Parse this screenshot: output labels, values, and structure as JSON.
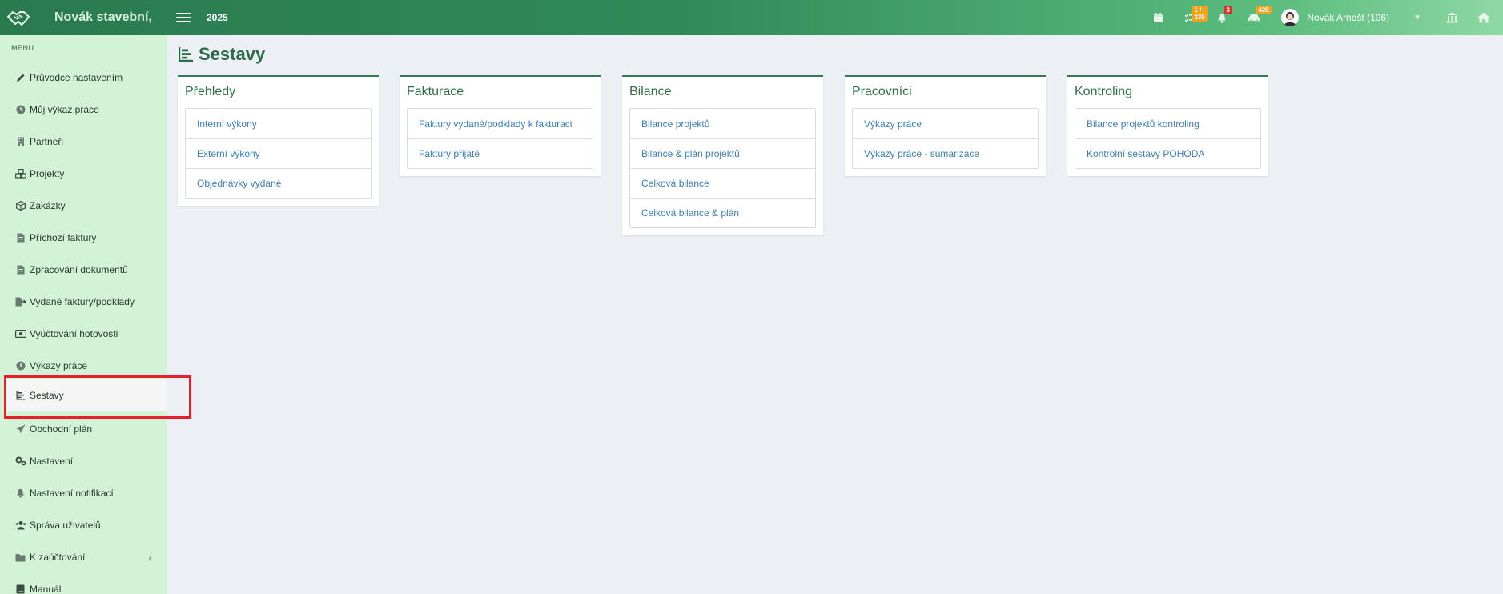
{
  "header": {
    "brand": "Novák stavební,",
    "year": "2025",
    "badges": {
      "tasks": "1 / 339",
      "notifications": "3",
      "cars": "428"
    },
    "user": "Novák Arnošt (106)"
  },
  "sidebar": {
    "caption": "MENU",
    "items": [
      {
        "label": "Průvodce nastavením",
        "icon": "pencil-icon"
      },
      {
        "label": "Můj výkaz práce",
        "icon": "clock-icon"
      },
      {
        "label": "Partneři",
        "icon": "building-icon"
      },
      {
        "label": "Projekty",
        "icon": "cubes-icon"
      },
      {
        "label": "Zakázky",
        "icon": "box-icon"
      },
      {
        "label": "Příchozí faktury",
        "icon": "file-invoice-icon"
      },
      {
        "label": "Zpracování dokumentů",
        "icon": "file-icon"
      },
      {
        "label": "Vydané faktury/podklady",
        "icon": "file-export-icon"
      },
      {
        "label": "Vyúčtování hotovosti",
        "icon": "money-icon"
      },
      {
        "label": "Výkazy práce",
        "icon": "clock-icon"
      },
      {
        "label": "Sestavy",
        "icon": "chart-bar-icon"
      },
      {
        "label": "Obchodní plán",
        "icon": "paper-plane-icon"
      },
      {
        "label": "Nastavení",
        "icon": "cogs-icon"
      },
      {
        "label": "Nastavení notifikací",
        "icon": "bell-icon"
      },
      {
        "label": "Správa uživatelů",
        "icon": "users-icon"
      },
      {
        "label": "K zaúčtování",
        "icon": "folder-icon"
      },
      {
        "label": "Manuál",
        "icon": "book-icon"
      }
    ]
  },
  "page": {
    "title": "Sestavy",
    "cards": [
      {
        "title": "Přehledy",
        "links": [
          "Interní výkony",
          "Externí výkony",
          "Objednávky vydané"
        ]
      },
      {
        "title": "Fakturace",
        "links": [
          "Faktury vydané/podklady k fakturaci",
          "Faktury přijaté"
        ]
      },
      {
        "title": "Bilance",
        "links": [
          "Bilance projektů",
          "Bilance & plán projektů",
          "Celková bilance",
          "Celková bilance & plán"
        ]
      },
      {
        "title": "Pracovníci",
        "links": [
          "Výkazy práce",
          "Výkazy práce - sumarizace"
        ]
      },
      {
        "title": "Kontroling",
        "links": [
          "Bilance projektů kontroling",
          "Kontrolní sestavy POHODA"
        ]
      }
    ]
  },
  "colors": {
    "accent": "#2f7a52",
    "link": "#3a7fb8",
    "sidebar": "#d3f3d6",
    "highlight": "#e8202a"
  }
}
